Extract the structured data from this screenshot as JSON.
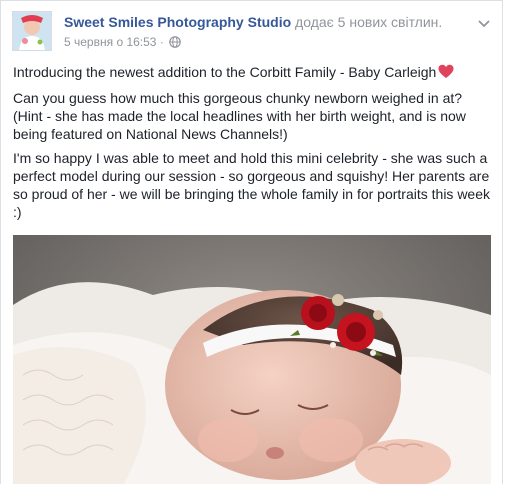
{
  "post": {
    "author": "Sweet Smiles Photography Studio",
    "action": " додає 5 нових світлин.",
    "timestamp": "5 червня о 16:53",
    "separator": " · ",
    "privacy_icon": "globe-icon",
    "menu_icon": "chevron-down-icon",
    "paragraphs": {
      "p1": "Introducing the newest addition to the Corbitt Family - Baby Carleigh",
      "p2": "Can you guess how much this gorgeous chunky newborn weighed in at? (Hint - she has made the local headlines with her birth weight, and is now being featured on National News Channels!)",
      "p3": "I'm so happy I was able to meet and hold this mini celebrity - she was such a perfect model during our session - so gorgeous and squishy! Her parents are so proud of her - we will be bringing the whole family in for portraits this week :)"
    },
    "emoji": "heart-icon",
    "colors": {
      "link": "#365899",
      "meta": "#90949c",
      "text": "#1d2129",
      "heart": "#e0445c"
    }
  }
}
